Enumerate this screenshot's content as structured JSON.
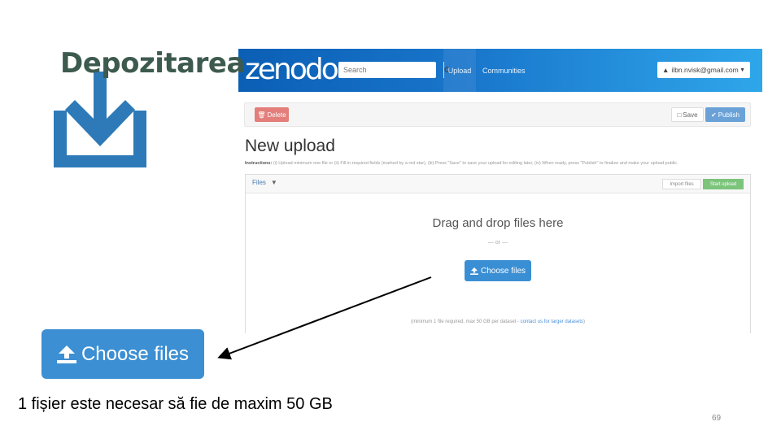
{
  "slide": {
    "title": "Depozitarea",
    "caption": "1 fișier este necesar să fie de maxim 50 GB",
    "page_number": "69",
    "big_button_label": "Choose files"
  },
  "zenodo": {
    "logo": "zenodo",
    "search_placeholder": "Search",
    "nav": {
      "upload": "Upload",
      "communities": "Communities"
    },
    "user_email": "ilbn.nvisk@gmail.com",
    "toolbar": {
      "delete": "Delete",
      "save": "Save",
      "publish": "Publish"
    },
    "heading": "New upload",
    "instructions_label": "Instructions:",
    "instructions_text": "(i) Upload minimum one file or (ii) Fill in required fields (marked by a red star), (iii) Press \"Save\" to save your upload for editing later, (iv) When ready, press \"Publish\" to finalize and make your upload public.",
    "files_tab": "Files",
    "import_button": "Import files",
    "start_button": "Start upload",
    "drop_title": "Drag and drop files here",
    "drop_or": "— or —",
    "choose_button": "Choose files",
    "note_text": "(minimum 1 file required, max 50 GB per dataset - ",
    "note_link": "contact us for larger datasets",
    "note_end": ")"
  },
  "colors": {
    "navbar_start": "#0b5fb5",
    "navbar_end": "#2fa6ea",
    "primary": "#3c8fd2",
    "delete": "#e37e7a",
    "publish": "#6aa2d8",
    "start": "#7cc47c",
    "title": "#3d5a4f",
    "icon": "#2e7ab8"
  }
}
